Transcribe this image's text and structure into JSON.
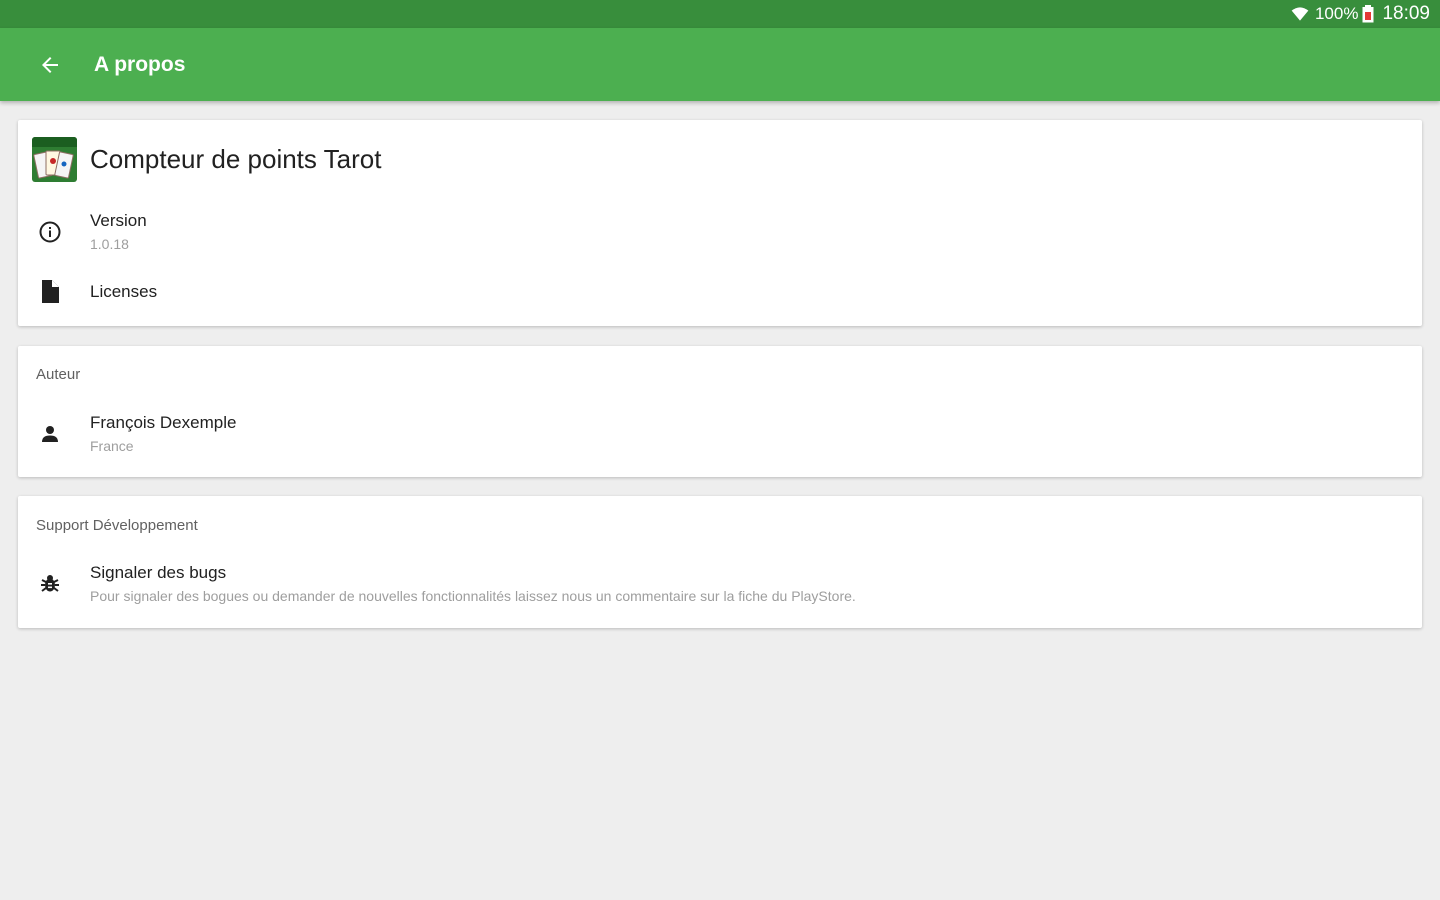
{
  "status_bar": {
    "battery_percent": "100%",
    "time": "18:09"
  },
  "app_bar": {
    "title": "A propos",
    "back_icon": "arrow-back-icon"
  },
  "app_info": {
    "name": "Compteur de points Tarot",
    "logo_icon": "tarot-app-logo",
    "version_label": "Version",
    "version_value": "1.0.18",
    "licenses_label": "Licenses"
  },
  "author_section": {
    "header": "Auteur",
    "name": "François Dexemple",
    "country": "France"
  },
  "support_section": {
    "header": "Support Développement",
    "bug_title": "Signaler des bugs",
    "bug_description": "Pour signaler des bogues ou demander de nouvelles fonctionnalités laissez nous un commentaire sur la fiche du PlayStore."
  },
  "colors": {
    "status_bar": "#388e3c",
    "app_bar": "#4caf50",
    "background": "#eeeeee",
    "battery_low": "#e53935"
  }
}
